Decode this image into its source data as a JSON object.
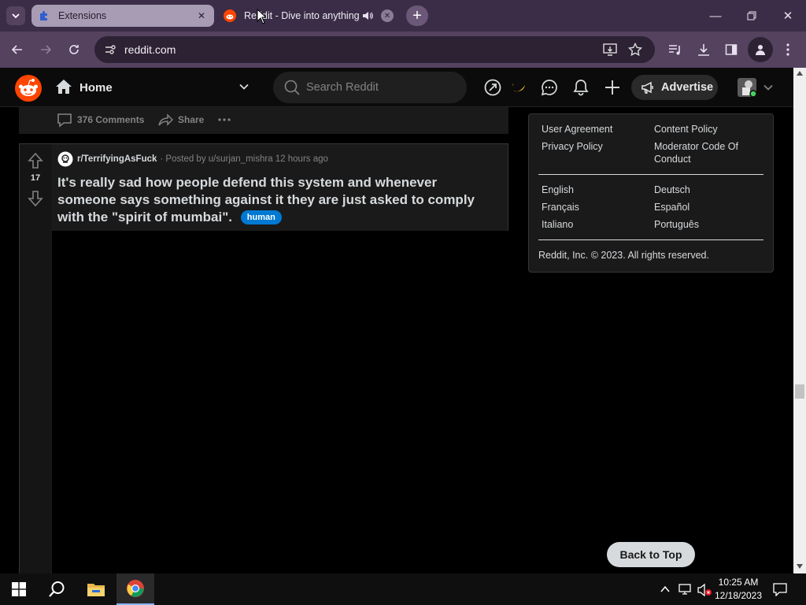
{
  "browser": {
    "tabs": [
      {
        "title": "Extensions",
        "icon": "puzzle-icon"
      },
      {
        "title": "Reddit - Dive into anything",
        "icon": "reddit-icon"
      }
    ],
    "url": "reddit.com"
  },
  "reddit": {
    "header": {
      "feed_label": "Home",
      "search_placeholder": "Search Reddit",
      "advertise_label": "Advertise"
    },
    "feed_top_actions": {
      "comments": "376 Comments",
      "share": "Share"
    },
    "post": {
      "votes": "17",
      "subreddit": "r/TerrifyingAsFuck",
      "posted_by": "· Posted by u/surjan_mishra 12 hours ago",
      "title": "It's really sad how people defend this system and whenever someone says something against it they are just asked to comply with the \"spirit of mumbai\".",
      "flair": "human",
      "flair_color": "#0079d3"
    },
    "footer": {
      "links": [
        "User Agreement",
        "Content Policy",
        "Privacy Policy",
        "Moderator Code Of Conduct"
      ],
      "languages": [
        "English",
        "Deutsch",
        "Français",
        "Español",
        "Italiano",
        "Português"
      ],
      "copyright": "Reddit, Inc. © 2023. All rights reserved."
    },
    "back_to_top": "Back to Top",
    "brand_color": "#ff4500"
  },
  "taskbar": {
    "time": "10:25 AM",
    "date": "12/18/2023"
  }
}
